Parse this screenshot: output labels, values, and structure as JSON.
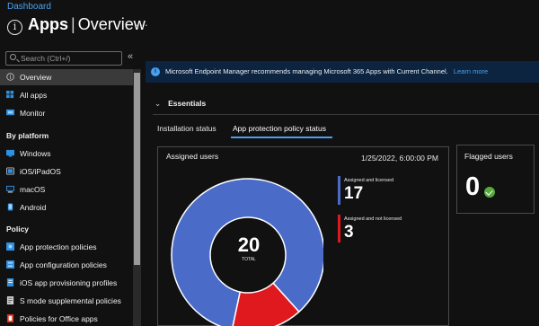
{
  "breadcrumb": "Dashboard",
  "header": {
    "title": "Apps",
    "separator": "|",
    "subtitle": "Overview"
  },
  "search": {
    "placeholder": "Search (Ctrl+/)",
    "collapse_icon": "«"
  },
  "sidebar": {
    "items": [
      {
        "label": "Overview",
        "icon": "info-icon",
        "selected": true
      },
      {
        "label": "All apps",
        "icon": "grid-icon"
      },
      {
        "label": "Monitor",
        "icon": "monitor-icon"
      }
    ],
    "sections": [
      {
        "title": "By platform",
        "items": [
          {
            "label": "Windows",
            "icon": "windows-icon"
          },
          {
            "label": "iOS/iPadOS",
            "icon": "apple-device-icon"
          },
          {
            "label": "macOS",
            "icon": "mac-icon"
          },
          {
            "label": "Android",
            "icon": "android-icon"
          }
        ]
      },
      {
        "title": "Policy",
        "items": [
          {
            "label": "App protection policies",
            "icon": "shield-icon"
          },
          {
            "label": "App configuration policies",
            "icon": "config-icon"
          },
          {
            "label": "iOS app provisioning profiles",
            "icon": "profile-icon"
          },
          {
            "label": "S mode supplemental policies",
            "icon": "policy-icon"
          },
          {
            "label": "Policies for Office apps",
            "icon": "office-icon"
          }
        ]
      }
    ]
  },
  "banner": {
    "text": "Microsoft Endpoint Manager recommends managing Microsoft 365 Apps with Current Channel.",
    "link": "Learn more"
  },
  "essentials": {
    "label": "Essentials"
  },
  "tabs": [
    {
      "label": "Installation status",
      "active": false
    },
    {
      "label": "App protection policy status",
      "active": true
    }
  ],
  "assigned_card": {
    "title": "Assigned users",
    "date": "1/25/2022, 6:00:00 PM",
    "total": "20",
    "total_label": "TOTAL",
    "legend": [
      {
        "label": "Assigned and licensed",
        "value": "17",
        "color": "#4b6bc8"
      },
      {
        "label": "Assigned and not licensed",
        "value": "3",
        "color": "#e0191f"
      }
    ]
  },
  "flagged_card": {
    "title": "Flagged users",
    "value": "0"
  },
  "chart_data": {
    "type": "pie",
    "title": "Assigned users",
    "categories": [
      "Assigned and licensed",
      "Assigned and not licensed"
    ],
    "values": [
      17,
      3
    ],
    "colors": [
      "#4b6bc8",
      "#e0191f"
    ],
    "total": 20
  }
}
